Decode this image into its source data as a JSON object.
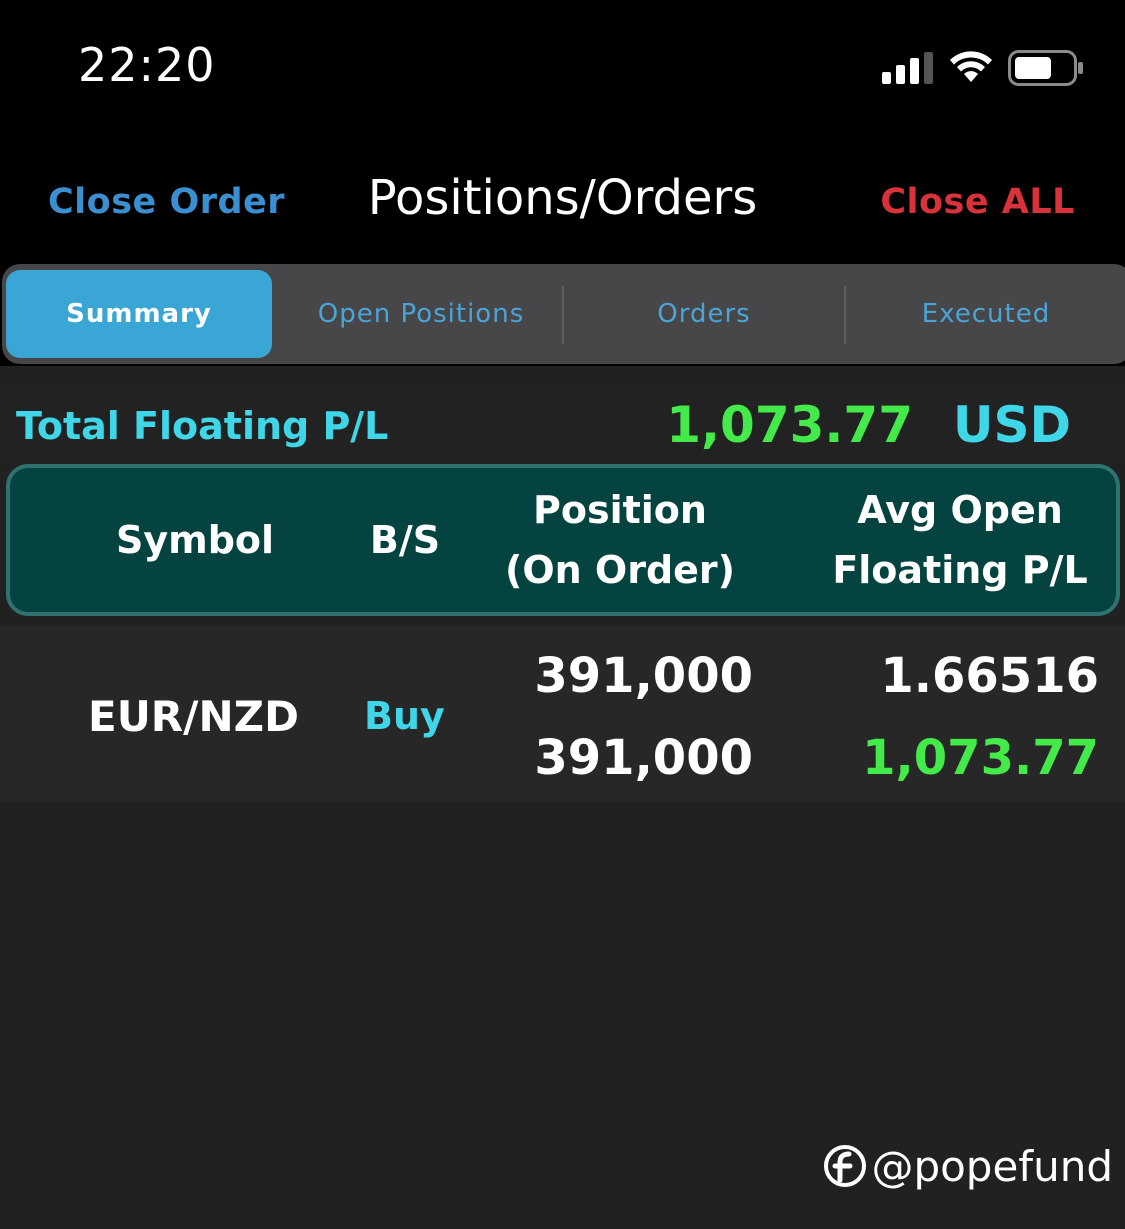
{
  "status_bar": {
    "time": "22:20",
    "icons": [
      "signal-icon",
      "wifi-icon",
      "battery-icon"
    ]
  },
  "nav": {
    "left_button": "Close Order",
    "title": "Positions/Orders",
    "right_button": "Close ALL"
  },
  "tabs": [
    {
      "label": "Summary",
      "active": true
    },
    {
      "label": "Open Positions",
      "active": false
    },
    {
      "label": "Orders",
      "active": false
    },
    {
      "label": "Executed",
      "active": false
    }
  ],
  "summary": {
    "label": "Total Floating P/L",
    "value": "1,073.77",
    "currency": "USD"
  },
  "table": {
    "headers": {
      "symbol": "Symbol",
      "bs": "B/S",
      "position_line1": "Position",
      "position_line2": "(On Order)",
      "avg_line1": "Avg Open",
      "avg_line2": "Floating P/L"
    },
    "rows": [
      {
        "symbol": "EUR/NZD",
        "bs": "Buy",
        "position": "391,000",
        "on_order": "391,000",
        "avg_open": "1.66516",
        "floating_pl": "1,073.77"
      }
    ]
  },
  "watermark": {
    "text": "@popefund"
  },
  "colors": {
    "accent_blue": "#3b8fd0",
    "close_red": "#d8333a",
    "cyan": "#3fd6e8",
    "profit_green": "#43ea4a",
    "header_teal": "#04433f"
  }
}
